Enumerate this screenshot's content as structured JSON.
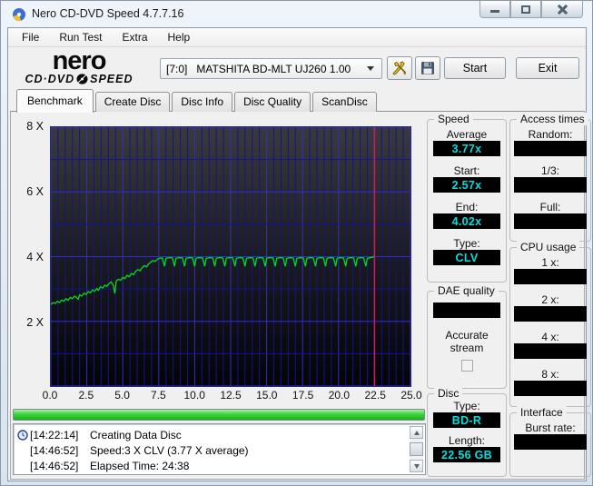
{
  "window": {
    "title": "Nero CD-DVD Speed 4.7.7.16"
  },
  "menu": {
    "items": [
      "File",
      "Run Test",
      "Extra",
      "Help"
    ]
  },
  "toolbar": {
    "logo_line1": "nero",
    "logo_line2a": "CD·DVD",
    "logo_line2b": "SPEED",
    "drive": "[7:0]   MATSHITA BD-MLT UJ260 1.00",
    "start_label": "Start",
    "exit_label": "Exit"
  },
  "tabs": [
    "Benchmark",
    "Create Disc",
    "Disc Info",
    "Disc Quality",
    "ScanDisc"
  ],
  "chart_data": {
    "type": "line",
    "xlabel": "",
    "ylabel": "",
    "xlim": [
      0,
      25
    ],
    "ylim": [
      0,
      8
    ],
    "x_minor_step": 0.5,
    "x_major_step": 2.5,
    "y_minor_step": 1,
    "y_major_step": 2,
    "x_tick_labels": [
      "0.0",
      "2.5",
      "5.0",
      "7.5",
      "10.0",
      "12.5",
      "15.0",
      "17.5",
      "20.0",
      "22.5",
      "25.0"
    ],
    "y_tick_labels": [
      "8 X",
      "6 X",
      "4 X",
      "2 X"
    ],
    "grid": true,
    "end_marker_x": 22.5,
    "series": [
      {
        "name": "write-transfer-rate",
        "points": [
          [
            0.0,
            2.52
          ],
          [
            0.15,
            2.58
          ],
          [
            0.3,
            2.55
          ],
          [
            0.45,
            2.62
          ],
          [
            0.6,
            2.58
          ],
          [
            0.75,
            2.66
          ],
          [
            0.9,
            2.62
          ],
          [
            1.05,
            2.7
          ],
          [
            1.2,
            2.65
          ],
          [
            1.35,
            2.74
          ],
          [
            1.5,
            2.7
          ],
          [
            1.65,
            2.78
          ],
          [
            1.8,
            2.73
          ],
          [
            1.9,
            2.68
          ],
          [
            2.0,
            2.82
          ],
          [
            2.15,
            2.78
          ],
          [
            2.3,
            2.87
          ],
          [
            2.45,
            2.83
          ],
          [
            2.6,
            2.92
          ],
          [
            2.75,
            2.88
          ],
          [
            2.9,
            2.97
          ],
          [
            3.05,
            2.93
          ],
          [
            3.2,
            3.02
          ],
          [
            3.3,
            2.96
          ],
          [
            3.45,
            3.07
          ],
          [
            3.6,
            3.03
          ],
          [
            3.75,
            3.12
          ],
          [
            3.9,
            3.08
          ],
          [
            4.05,
            3.17
          ],
          [
            4.2,
            3.22
          ],
          [
            4.35,
            3.1
          ],
          [
            4.45,
            2.86
          ],
          [
            4.55,
            3.25
          ],
          [
            4.7,
            3.3
          ],
          [
            4.85,
            3.27
          ],
          [
            5.0,
            3.36
          ],
          [
            5.15,
            3.32
          ],
          [
            5.3,
            3.42
          ],
          [
            5.45,
            3.38
          ],
          [
            5.6,
            3.48
          ],
          [
            5.75,
            3.44
          ],
          [
            5.9,
            3.55
          ],
          [
            6.05,
            3.6
          ],
          [
            6.2,
            3.56
          ],
          [
            6.35,
            3.66
          ],
          [
            6.5,
            3.72
          ],
          [
            6.65,
            3.68
          ],
          [
            6.8,
            3.78
          ],
          [
            6.95,
            3.83
          ],
          [
            7.1,
            3.88
          ],
          [
            7.25,
            3.85
          ],
          [
            7.4,
            3.92
          ],
          [
            7.55,
            3.95
          ],
          [
            7.75,
            3.96
          ],
          [
            7.9,
            3.7
          ],
          [
            8.0,
            3.95
          ],
          [
            8.25,
            3.97
          ],
          [
            8.45,
            3.96
          ],
          [
            8.6,
            3.7
          ],
          [
            8.7,
            3.95
          ],
          [
            8.95,
            3.97
          ],
          [
            9.15,
            3.96
          ],
          [
            9.3,
            3.7
          ],
          [
            9.4,
            3.95
          ],
          [
            9.65,
            3.97
          ],
          [
            9.85,
            3.96
          ],
          [
            10.0,
            3.7
          ],
          [
            10.1,
            3.95
          ],
          [
            10.35,
            3.97
          ],
          [
            10.55,
            3.96
          ],
          [
            10.7,
            3.7
          ],
          [
            10.8,
            3.95
          ],
          [
            11.05,
            3.97
          ],
          [
            11.25,
            3.96
          ],
          [
            11.4,
            3.7
          ],
          [
            11.5,
            3.95
          ],
          [
            11.75,
            3.97
          ],
          [
            11.95,
            3.96
          ],
          [
            12.1,
            3.7
          ],
          [
            12.2,
            3.95
          ],
          [
            12.45,
            3.97
          ],
          [
            12.65,
            3.96
          ],
          [
            12.8,
            3.7
          ],
          [
            12.9,
            3.95
          ],
          [
            13.15,
            3.97
          ],
          [
            13.35,
            3.96
          ],
          [
            13.5,
            3.7
          ],
          [
            13.6,
            3.95
          ],
          [
            13.85,
            3.97
          ],
          [
            14.05,
            3.96
          ],
          [
            14.2,
            3.7
          ],
          [
            14.3,
            3.95
          ],
          [
            14.55,
            3.97
          ],
          [
            14.75,
            3.96
          ],
          [
            14.9,
            3.7
          ],
          [
            15.0,
            3.95
          ],
          [
            15.25,
            3.97
          ],
          [
            15.45,
            3.96
          ],
          [
            15.6,
            3.7
          ],
          [
            15.7,
            3.95
          ],
          [
            15.95,
            3.97
          ],
          [
            16.15,
            3.96
          ],
          [
            16.3,
            3.7
          ],
          [
            16.4,
            3.95
          ],
          [
            16.65,
            3.97
          ],
          [
            16.85,
            3.96
          ],
          [
            17.0,
            3.7
          ],
          [
            17.1,
            3.95
          ],
          [
            17.35,
            3.97
          ],
          [
            17.55,
            3.96
          ],
          [
            17.7,
            3.7
          ],
          [
            17.8,
            3.95
          ],
          [
            18.05,
            3.97
          ],
          [
            18.25,
            3.96
          ],
          [
            18.4,
            3.7
          ],
          [
            18.5,
            3.95
          ],
          [
            18.75,
            3.97
          ],
          [
            18.95,
            3.96
          ],
          [
            19.1,
            3.7
          ],
          [
            19.2,
            3.95
          ],
          [
            19.45,
            3.97
          ],
          [
            19.65,
            3.96
          ],
          [
            19.8,
            3.7
          ],
          [
            19.9,
            3.95
          ],
          [
            20.15,
            3.97
          ],
          [
            20.35,
            3.96
          ],
          [
            20.5,
            3.7
          ],
          [
            20.6,
            3.95
          ],
          [
            20.85,
            3.97
          ],
          [
            21.05,
            3.96
          ],
          [
            21.2,
            3.7
          ],
          [
            21.3,
            3.95
          ],
          [
            21.55,
            3.97
          ],
          [
            21.75,
            3.96
          ],
          [
            21.9,
            3.7
          ],
          [
            22.0,
            3.95
          ],
          [
            22.25,
            3.97
          ],
          [
            22.4,
            3.99
          ],
          [
            22.5,
            4.02
          ]
        ]
      }
    ]
  },
  "panels": {
    "speed": {
      "title": "Speed",
      "fields": [
        {
          "label": "Average",
          "value": "3.77x"
        },
        {
          "label": "Start:",
          "value": "2.57x"
        },
        {
          "label": "End:",
          "value": "4.02x"
        },
        {
          "label": "Type:",
          "value": "CLV"
        }
      ]
    },
    "access": {
      "title": "Access times",
      "fields": [
        {
          "label": "Random:",
          "value": ""
        },
        {
          "label": "1/3:",
          "value": ""
        },
        {
          "label": "Full:",
          "value": ""
        }
      ]
    },
    "cpu": {
      "title": "CPU usage",
      "fields": [
        {
          "label": "1 x:",
          "value": ""
        },
        {
          "label": "2 x:",
          "value": ""
        },
        {
          "label": "4 x:",
          "value": ""
        },
        {
          "label": "8 x:",
          "value": ""
        }
      ]
    },
    "dae": {
      "title": "DAE quality",
      "value": "",
      "checkbox_label_1": "Accurate",
      "checkbox_label_2": "stream"
    },
    "disc": {
      "title": "Disc",
      "fields": [
        {
          "label": "Type:",
          "value": "BD-R"
        },
        {
          "label": "Length:",
          "value": "22.56 GB"
        }
      ]
    },
    "interface": {
      "title": "Interface",
      "fields": [
        {
          "label": "Burst rate:",
          "value": ""
        }
      ]
    }
  },
  "log": {
    "lines": [
      {
        "time": "[14:22:14]",
        "text": "Creating Data Disc"
      },
      {
        "time": "[14:46:52]",
        "text": "Speed:3 X CLV (3.77 X average)"
      },
      {
        "time": "[14:46:52]",
        "text": "Elapsed Time: 24:38"
      }
    ]
  },
  "colors": {
    "grid_minor": "#12129e",
    "grid_major": "#2d2de0",
    "curve": "#00dc1e",
    "marker": "#d4157f",
    "value_text": "#00e0e0",
    "value_bg": "#000000",
    "progress_green": "#2ec82e"
  }
}
